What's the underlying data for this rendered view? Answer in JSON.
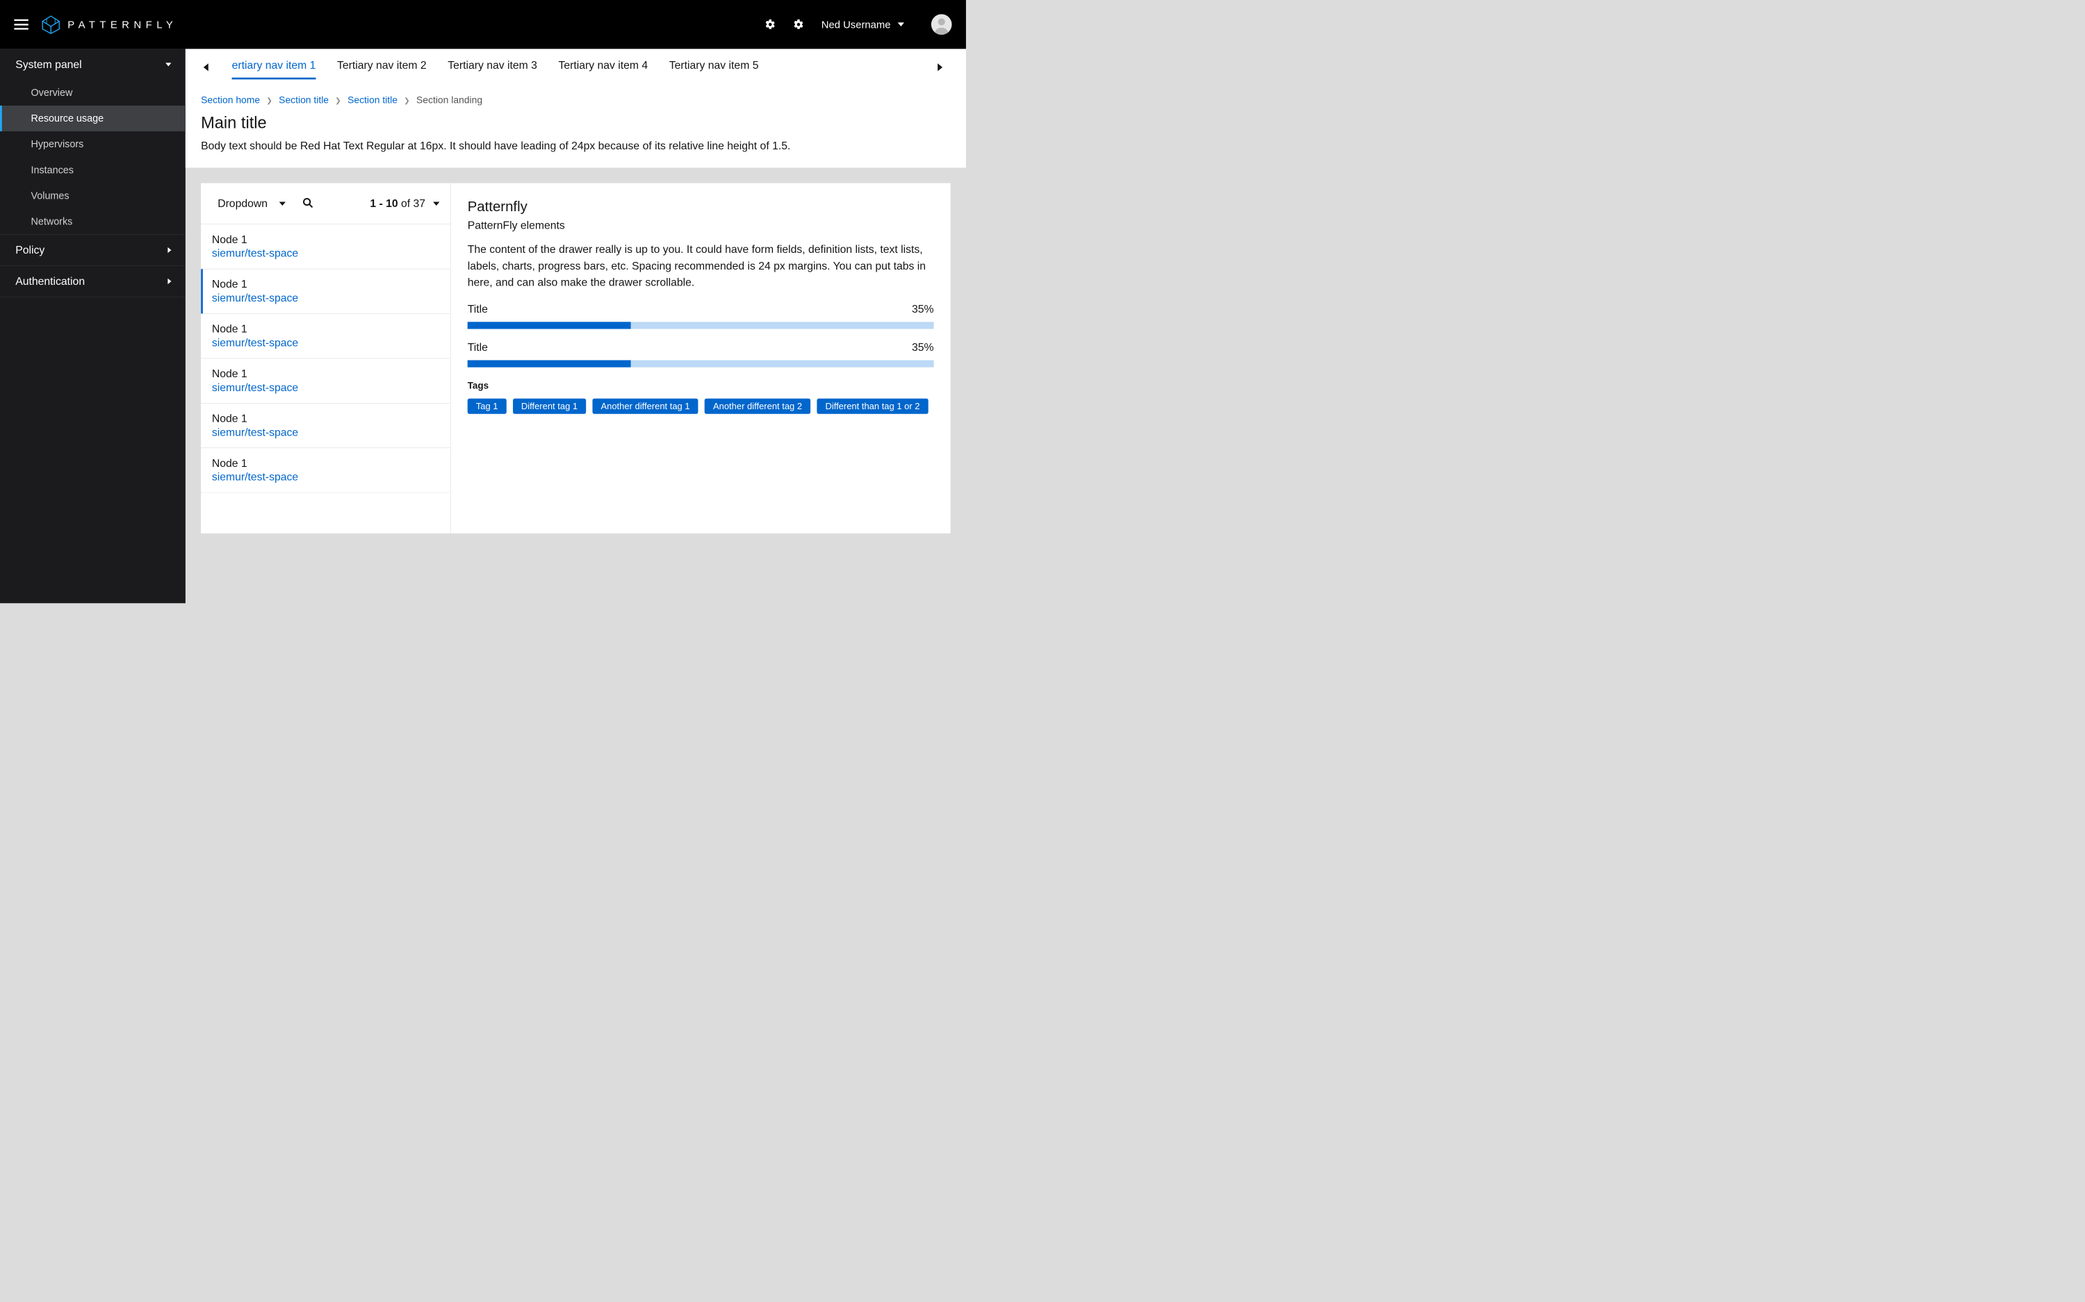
{
  "header": {
    "brand": "PATTERNFLY",
    "username": "Ned Username"
  },
  "sidebar": {
    "sections": [
      {
        "label": "System panel",
        "expanded": true,
        "items": [
          {
            "label": "Overview"
          },
          {
            "label": "Resource usage",
            "active": true
          },
          {
            "label": "Hypervisors"
          },
          {
            "label": "Instances"
          },
          {
            "label": "Volumes"
          },
          {
            "label": "Networks"
          }
        ]
      },
      {
        "label": "Policy",
        "expanded": false
      },
      {
        "label": "Authentication",
        "expanded": false
      }
    ]
  },
  "tertiary": {
    "tabs": [
      "ertiary nav item 1",
      "Tertiary nav item 2",
      "Tertiary nav item 3",
      "Tertiary nav item 4",
      "Tertiary nav item 5"
    ]
  },
  "breadcrumb": {
    "home": "Section home",
    "a": "Section title",
    "b": "Section title",
    "current": "Section landing"
  },
  "page": {
    "title": "Main title",
    "body": "Body text should be Red Hat Text Regular at 16px. It should have leading of 24px because of its relative line height of 1.5."
  },
  "list": {
    "dropdown": "Dropdown",
    "pager_range": "1 - 10",
    "pager_of": " of ",
    "pager_total": "37",
    "nodes": [
      {
        "name": "Node 1",
        "sub": "siemur/test-space"
      },
      {
        "name": "Node 1",
        "sub": "siemur/test-space",
        "selected": true
      },
      {
        "name": "Node 1",
        "sub": "siemur/test-space"
      },
      {
        "name": "Node 1",
        "sub": "siemur/test-space"
      },
      {
        "name": "Node 1",
        "sub": "siemur/test-space"
      },
      {
        "name": "Node 1",
        "sub": "siemur/test-space"
      }
    ]
  },
  "detail": {
    "title": "Patternfly",
    "subtitle": "PatternFly elements",
    "body": "The content of the drawer really is up to you. It could have form fields, definition lists, text lists, labels, charts, progress bars, etc. Spacing recommended is 24 px margins. You can put tabs in here, and can also make the drawer scrollable.",
    "progress": [
      {
        "label": "Title",
        "value": "35%",
        "pct": 35
      },
      {
        "label": "Title",
        "value": "35%",
        "pct": 35
      }
    ],
    "tags_label": "Tags",
    "tags": [
      "Tag 1",
      "Different tag 1",
      "Another different tag 1",
      "Another different tag 2",
      "Different than tag 1 or 2"
    ]
  }
}
